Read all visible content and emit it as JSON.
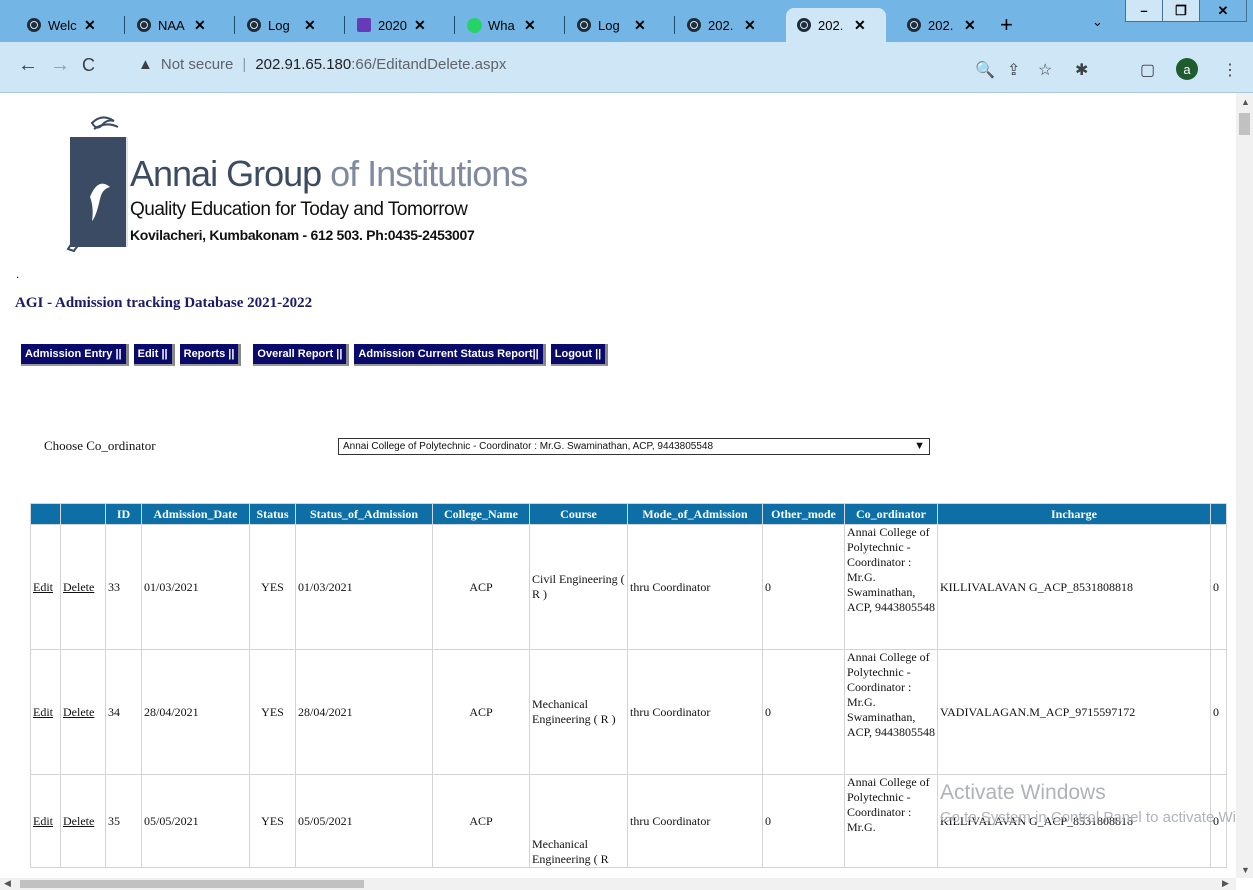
{
  "browser": {
    "tabs": [
      {
        "title": "Welc",
        "icon": "globe-icon"
      },
      {
        "title": "NAA",
        "icon": "globe-icon"
      },
      {
        "title": "Log",
        "icon": "globe-icon"
      },
      {
        "title": "2020",
        "icon": "forms-icon"
      },
      {
        "title": "Wha",
        "icon": "whatsapp-icon"
      },
      {
        "title": "Log",
        "icon": "globe-icon"
      },
      {
        "title": "202.",
        "icon": "globe-icon"
      },
      {
        "title": "202.",
        "icon": "globe-icon"
      },
      {
        "title": "202.",
        "icon": "globe-icon"
      }
    ],
    "close_glyph": "✕",
    "new_tab": "+",
    "tab_list": "⌄",
    "window_buttons": [
      "–",
      "❐",
      "✕"
    ],
    "nav": {
      "back": "←",
      "forward": "→",
      "reload": "C"
    },
    "security_warning": "▲",
    "security_label": "Not secure",
    "url_host": "202.91.65.180",
    "url_path": ":66/EditandDelete.aspx",
    "toolbar_icons": [
      "🔍",
      "⇪",
      "☆",
      "✱",
      "▢",
      "⋮"
    ],
    "profile_initial": "a"
  },
  "logo": {
    "name_main": "Annai Group",
    "name_suffix": " of Institutions",
    "tagline": "Quality Education for Today and Tomorrow",
    "address": "Kovilacheri, Kumbakonam - 612 503. Ph:0435-2453007"
  },
  "page": {
    "dot": ".",
    "heading": "AGI - Admission tracking Database 2021-2022",
    "menu": [
      "Admission Entry ||",
      "Edit ||",
      "Reports ||",
      "Overall Report ||",
      "Admission Current Status Report||",
      "Logout ||"
    ],
    "coordinator_label": "Choose Co_ordinator",
    "coordinator_selected": "Annai College of Polytechnic - Coordinator : Mr.G. Swaminathan, ACP, 9443805548",
    "caret": "▼"
  },
  "table": {
    "headers": [
      "",
      "",
      "ID",
      "Admission_Date",
      "Status",
      "Status_of_Admission",
      "College_Name",
      "Course",
      "Mode_of_Admission",
      "Other_mode",
      "Co_ordinator",
      "Incharge",
      ""
    ],
    "edit_label": "Edit",
    "delete_label": "Delete",
    "rows": [
      {
        "id": "33",
        "admission_date": "01/03/2021",
        "status": "YES",
        "status_of_admission": "01/03/2021",
        "college": "ACP",
        "course": "Civil Engineering ( R )",
        "mode": "thru Coordinator",
        "other_mode": "0",
        "coordinator": "Annai College of Polytechnic - Coordinator : Mr.G. Swaminathan, ACP, 9443805548",
        "incharge": "KILLIVALAVAN G_ACP_8531808818",
        "extra": "0"
      },
      {
        "id": "34",
        "admission_date": "28/04/2021",
        "status": "YES",
        "status_of_admission": "28/04/2021",
        "college": "ACP",
        "course": "Mechanical Engineering ( R )",
        "mode": "thru Coordinator",
        "other_mode": "0",
        "coordinator": "Annai College of Polytechnic - Coordinator : Mr.G. Swaminathan, ACP, 9443805548",
        "incharge": "VADIVALAGAN.M_ACP_9715597172",
        "extra": "0"
      },
      {
        "id": "35",
        "admission_date": "05/05/2021",
        "status": "YES",
        "status_of_admission": "05/05/2021",
        "college": "ACP",
        "course": "Mechanical Engineering ( R",
        "mode": "thru Coordinator",
        "other_mode": "0",
        "coordinator": "Annai College of Polytechnic - Coordinator : Mr.G.",
        "incharge": "KILLIVALAVAN G_ACP_8531808818",
        "extra": "0"
      }
    ]
  },
  "watermark": {
    "line1": "Activate Windows",
    "line2": "Go to System in Control Panel to activate Windows."
  },
  "colors": {
    "tab_strip": "#73b6e5",
    "toolbar": "#cfe6f7",
    "menu_bg": "#0a0a6a",
    "table_header": "#0e6fa6",
    "profile_avatar": "#1e5b2d"
  }
}
